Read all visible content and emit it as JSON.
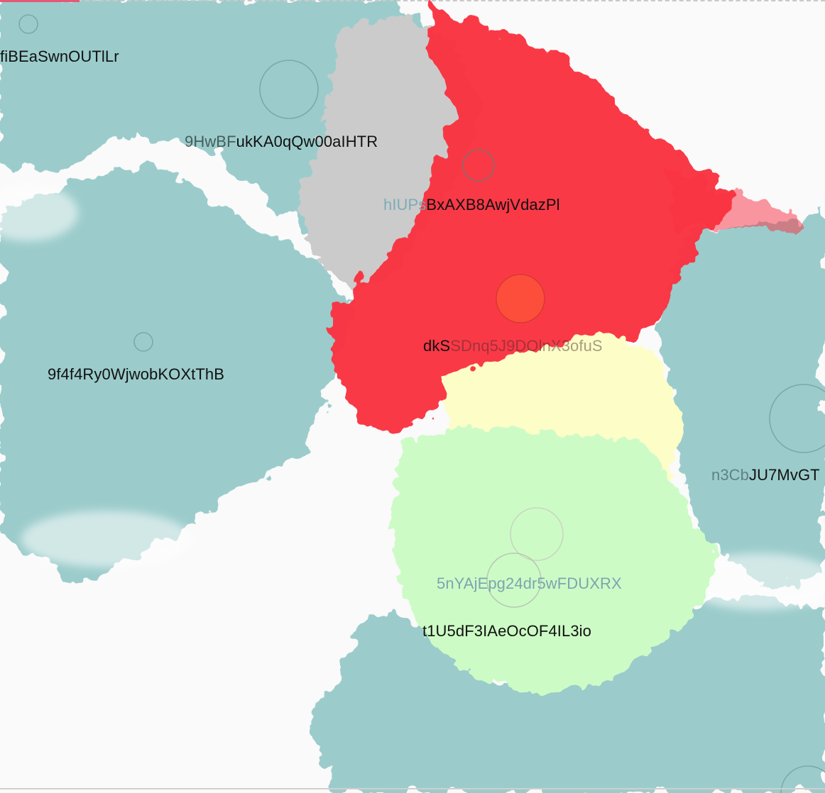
{
  "colors": {
    "background": "#fafafa",
    "teal_region": "#9bcccb",
    "gray_region": "#cbcbcb",
    "red_region": "#fa3340",
    "light_green_region": "#cdfbc6",
    "light_yellow_region": "#fdfdc8",
    "active_node": "#fd4e3c",
    "node_ring": "#7fa8a8"
  },
  "labels": {
    "fibea": {
      "main": "fiBEaSwnOUTlLr"
    },
    "hwbf": {
      "faded": "9HwBF",
      "main": "ukKA0qQw00aIHTR"
    },
    "hlup": {
      "faded": "hIUPs",
      "main": "BxAXB8AwjVdazPl"
    },
    "f4f4": {
      "main": "9f4f4Ry0WjwobKOXtThB"
    },
    "dks": {
      "main": "dkS",
      "faded": "SDnq5J9DOlnX3ofuS"
    },
    "n3cb": {
      "faded": "n3Cb",
      "main": "JU7MvGT"
    },
    "ynaj": {
      "main": "5nYAjEpg24dr5wFDUXRX"
    },
    "t1u5": {
      "main": "t1U5dF3IAeOcOF4IL3io"
    }
  }
}
